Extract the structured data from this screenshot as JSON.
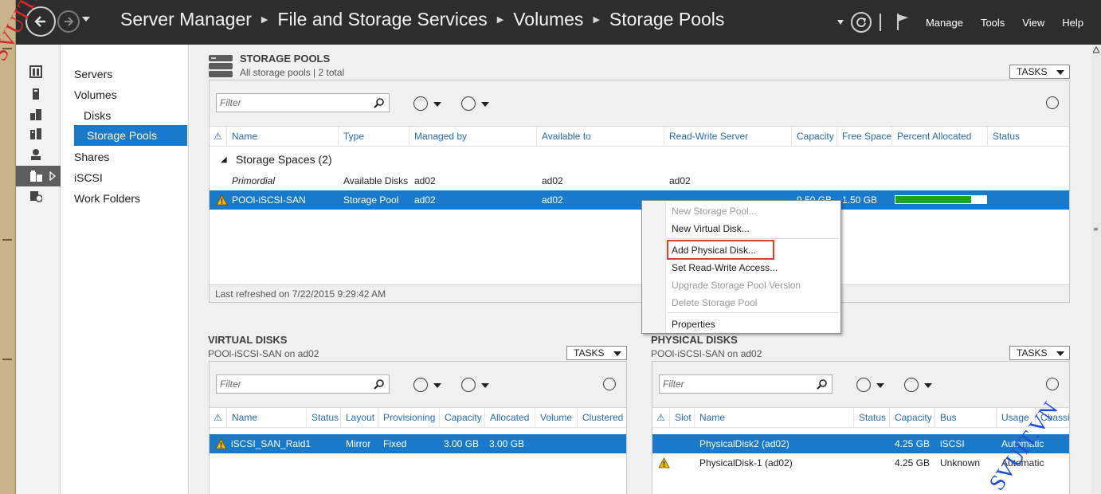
{
  "header": {
    "breadcrumb": [
      "Server Manager",
      "File and Storage Services",
      "Volumes",
      "Storage Pools"
    ],
    "menu": [
      "Manage",
      "Tools",
      "View",
      "Help"
    ]
  },
  "nav": {
    "items": [
      {
        "label": "Servers",
        "level": 0,
        "selected": false
      },
      {
        "label": "Volumes",
        "level": 0,
        "selected": false
      },
      {
        "label": "Disks",
        "level": 1,
        "selected": false
      },
      {
        "label": "Storage Pools",
        "level": 1,
        "selected": true
      },
      {
        "label": "Shares",
        "level": 0,
        "selected": false
      },
      {
        "label": "iSCSI",
        "level": 0,
        "selected": false
      },
      {
        "label": "Work Folders",
        "level": 0,
        "selected": false
      }
    ]
  },
  "storage_pools": {
    "title": "STORAGE POOLS",
    "subtitle": "All storage pools | 2 total",
    "tasks_label": "TASKS",
    "filter_placeholder": "Filter",
    "columns": [
      "Name",
      "Type",
      "Managed by",
      "Available to",
      "Read-Write Server",
      "Capacity",
      "Free Space",
      "Percent Allocated",
      "Status"
    ],
    "group_label": "Storage Spaces (2)",
    "rows": [
      {
        "name": "Primordial",
        "type": "Available Disks",
        "managed_by": "ad02",
        "available_to": "ad02",
        "rw_server": "ad02",
        "capacity": "",
        "free_space": "",
        "percent_allocated": null,
        "warning": false,
        "selected": false
      },
      {
        "name": "POOl-iSCSI-SAN",
        "type": "Storage Pool",
        "managed_by": "ad02",
        "available_to": "ad02",
        "rw_server": "",
        "capacity": "9.50 GB",
        "free_space": "1.50 GB",
        "percent_allocated": 0.83,
        "warning": true,
        "selected": true
      }
    ],
    "footer": "Last refreshed on 7/22/2015 9:29:42 AM"
  },
  "context_menu": {
    "items": [
      {
        "label": "New Storage Pool...",
        "disabled": true
      },
      {
        "label": "New Virtual Disk...",
        "disabled": false
      },
      {
        "label": "Add Physical Disk...",
        "disabled": false,
        "highlighted": true
      },
      {
        "label": "Set Read-Write Access...",
        "disabled": false
      },
      {
        "label": "Upgrade Storage Pool Version",
        "disabled": true
      },
      {
        "label": "Delete Storage Pool",
        "disabled": true
      },
      {
        "label": "Properties",
        "disabled": false
      }
    ]
  },
  "virtual_disks": {
    "title": "VIRTUAL DISKS",
    "subtitle": "POOl-iSCSI-SAN on ad02",
    "tasks_label": "TASKS",
    "filter_placeholder": "Filter",
    "columns": [
      "Name",
      "Status",
      "Layout",
      "Provisioning",
      "Capacity",
      "Allocated",
      "Volume",
      "Clustered"
    ],
    "rows": [
      {
        "name": "iSCSI_SAN_Raid1",
        "status": "",
        "layout": "Mirror",
        "provisioning": "Fixed",
        "capacity": "3.00 GB",
        "allocated": "3.00 GB",
        "volume": "",
        "clustered": "",
        "warning": true,
        "selected": true
      }
    ]
  },
  "physical_disks": {
    "title": "PHYSICAL DISKS",
    "subtitle": "POOl-iSCSI-SAN on ad02",
    "tasks_label": "TASKS",
    "filter_placeholder": "Filter",
    "columns": [
      "Slot",
      "Name",
      "Status",
      "Capacity",
      "Bus",
      "Usage",
      "Chassis"
    ],
    "rows": [
      {
        "slot": "",
        "name": "PhysicalDisk2 (ad02)",
        "status": "",
        "capacity": "4.25 GB",
        "bus": "iSCSI",
        "usage": "Automatic",
        "warning": false,
        "selected": true
      },
      {
        "slot": "",
        "name": "PhysicalDisk-1 (ad02)",
        "status": "",
        "capacity": "4.25 GB",
        "bus": "Unknown",
        "usage": "Automatic",
        "warning": true,
        "selected": false
      }
    ]
  },
  "watermarks": {
    "top_left": "SVUIT.VN",
    "bottom_right": "SVUIT.VN"
  },
  "colors": {
    "selection": "#1979ca",
    "header": "#2d2d2d",
    "progress": "#1ea31e",
    "highlight_box": "#e03c31",
    "warning": "#f2b800"
  }
}
